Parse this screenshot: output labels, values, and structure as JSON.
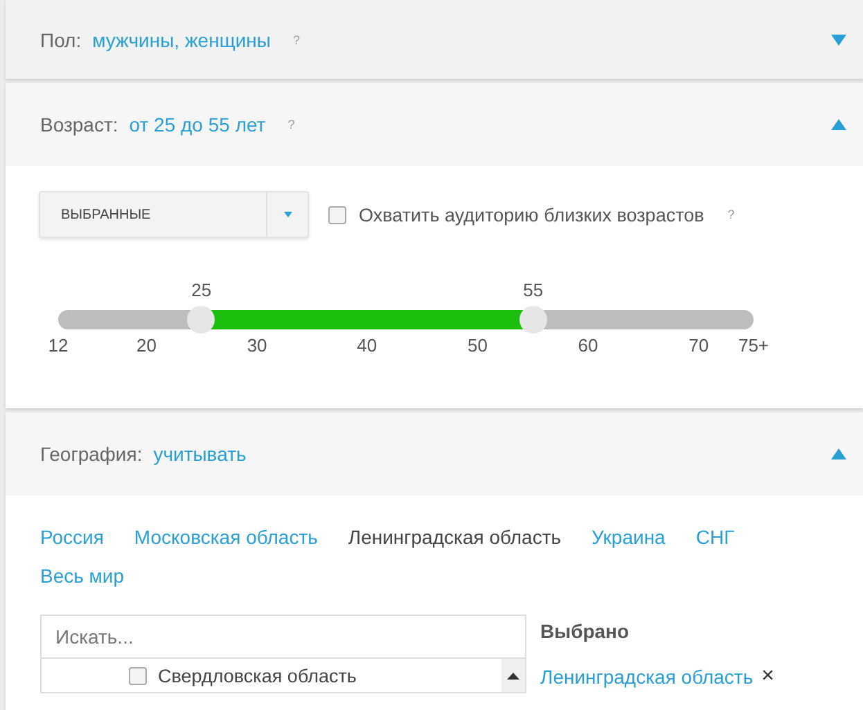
{
  "sections": [
    {
      "kind": "gender",
      "label": "Пол:",
      "value": "мужчины, женщины",
      "help": "?",
      "expanded": false
    },
    {
      "kind": "age",
      "label": "Возраст:",
      "value": "от 25 до 55 лет",
      "help": "?",
      "expanded": true
    },
    {
      "kind": "geo",
      "label": "География:",
      "value": "учитывать",
      "expanded": true
    }
  ],
  "age": {
    "select": "ВЫБРАННЫЕ",
    "checkbox": {
      "label": "Охватить аудиторию близких возрастов",
      "checked": false
    },
    "help": "?",
    "slider": {
      "low": {
        "reading": "25",
        "level": 0.206
      },
      "high": {
        "reading": "55",
        "level": 0.683
      },
      "ticks": [
        "12",
        "20",
        "30",
        "40",
        "50",
        "60",
        "70",
        "75+"
      ]
    }
  },
  "geo": {
    "tabs": [
      {
        "label": "Россия",
        "selected": false
      },
      {
        "label": "Московская область",
        "selected": false
      },
      {
        "label": "Ленинградская область",
        "selected": true
      },
      {
        "label": "Украина",
        "selected": false
      },
      {
        "label": "СНГ",
        "selected": false
      },
      {
        "label": "Весь мир",
        "selected": false
      }
    ],
    "search": {
      "placeholder": "Искать..."
    },
    "list": [
      {
        "label": "Свердловская область",
        "checked": false
      }
    ],
    "selected_title": "Выбрано",
    "selected_items": [
      {
        "label": "Ленинградская область",
        "remove": "×"
      }
    ]
  }
}
